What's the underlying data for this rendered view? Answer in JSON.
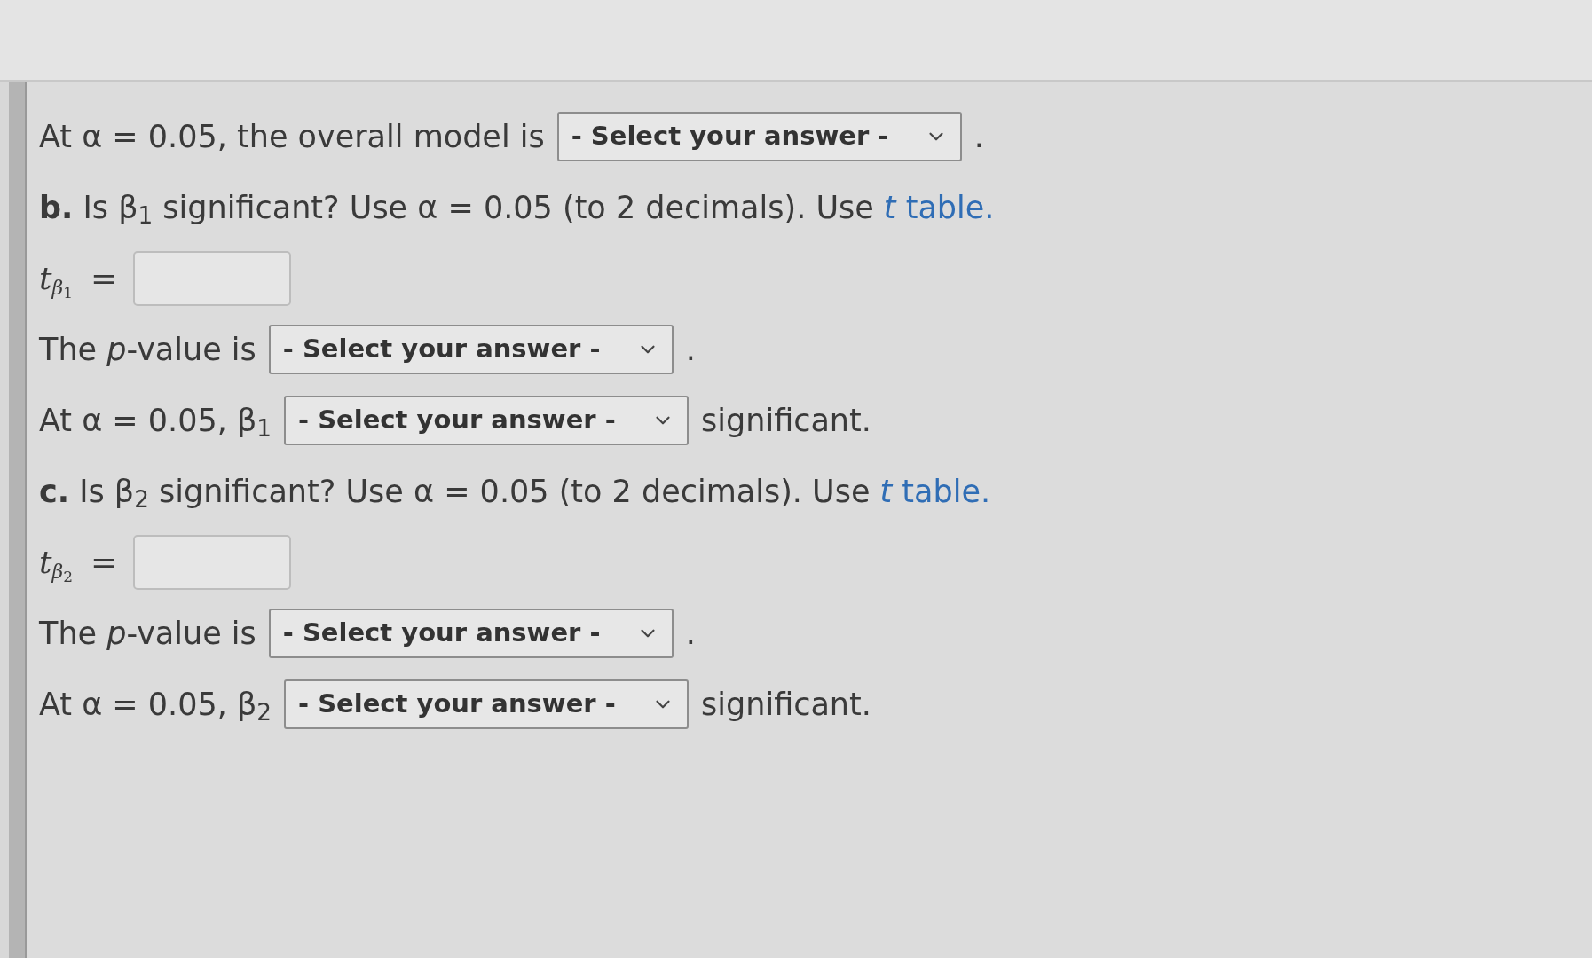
{
  "lines": [
    {
      "kind": "select_row",
      "before": "At α = 0.05, the overall model is",
      "select": "- Select your answer -",
      "after": "."
    },
    {
      "kind": "question",
      "text": "**b.** Is β$_{1}$ significant? Use α = 0.05 (to 2 decimals). Use",
      "link": "*t* table."
    },
    {
      "kind": "input_row",
      "symbol": "t",
      "subscript": "β",
      "index": "1",
      "relation": "="
    },
    {
      "kind": "select_row",
      "before": "The *p*-value is",
      "select": "- Select your answer -",
      "after": "."
    },
    {
      "kind": "select_row",
      "before": "At α = 0.05, β$_{1}$",
      "select": "- Select your answer -",
      "after": "significant."
    },
    {
      "kind": "question",
      "text": "**c.** Is β$_{2}$ significant? Use α = 0.05 (to 2 decimals). Use",
      "link": "*t* table."
    },
    {
      "kind": "input_row",
      "symbol": "t",
      "subscript": "β",
      "index": "2",
      "relation": "="
    },
    {
      "kind": "select_row",
      "before": "The *p*-value is",
      "select": "- Select your answer -",
      "after": "."
    },
    {
      "kind": "select_row",
      "before": "At α = 0.05, β$_{2}$",
      "select": "- Select your answer -",
      "after": "significant."
    }
  ]
}
